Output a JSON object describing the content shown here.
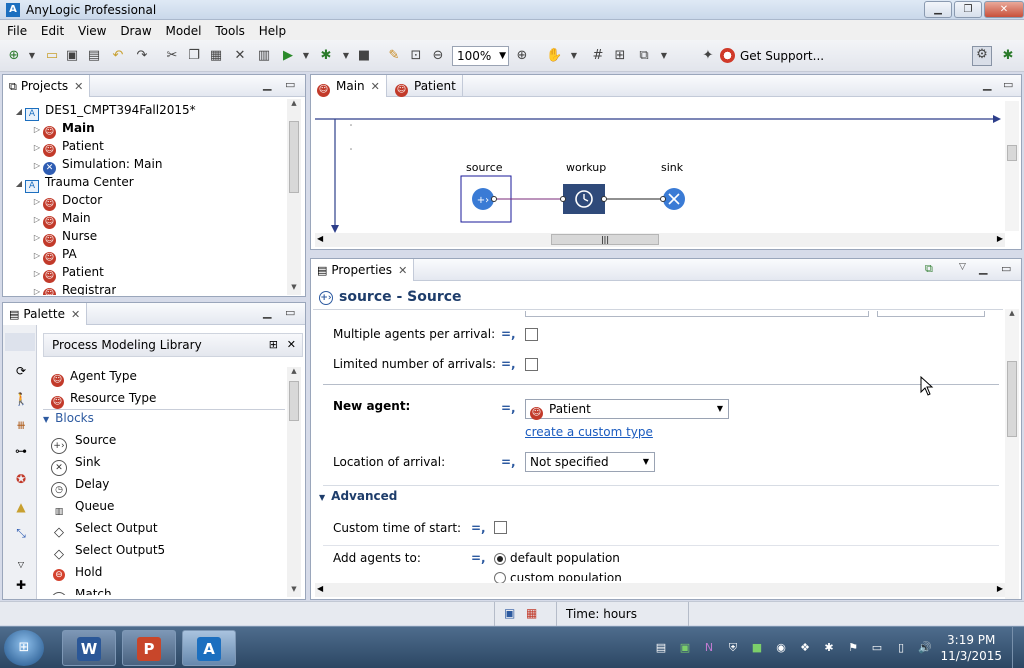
{
  "window": {
    "title": "AnyLogic Professional",
    "minimize": "▁",
    "maximize": "❐",
    "close": "✕"
  },
  "menu": [
    "File",
    "Edit",
    "View",
    "Draw",
    "Model",
    "Tools",
    "Help"
  ],
  "toolbar": {
    "zoom": "100%",
    "get_support": "Get Support..."
  },
  "projects": {
    "tab": "Projects",
    "items": [
      {
        "label": "DES1_CMPT394Fall2015*",
        "level": 0,
        "type": "project",
        "expanded": true
      },
      {
        "label": "Main",
        "level": 1,
        "type": "agent",
        "bold": true
      },
      {
        "label": "Patient",
        "level": 1,
        "type": "agent"
      },
      {
        "label": "Simulation: Main",
        "level": 1,
        "type": "sim"
      },
      {
        "label": "Trauma Center",
        "level": 0,
        "type": "project",
        "expanded": true
      },
      {
        "label": "Doctor",
        "level": 1,
        "type": "agent"
      },
      {
        "label": "Main",
        "level": 1,
        "type": "agent"
      },
      {
        "label": "Nurse",
        "level": 1,
        "type": "agent"
      },
      {
        "label": "PA",
        "level": 1,
        "type": "agent"
      },
      {
        "label": "Patient",
        "level": 1,
        "type": "agent"
      },
      {
        "label": "Registrar",
        "level": 1,
        "type": "agent"
      }
    ]
  },
  "palette": {
    "tab": "Palette",
    "library": "Process Modeling Library",
    "top_items": [
      "Agent Type",
      "Resource Type"
    ],
    "section": "Blocks",
    "blocks": [
      "Source",
      "Sink",
      "Delay",
      "Queue",
      "Select Output",
      "Select Output5",
      "Hold",
      "Match"
    ]
  },
  "editor": {
    "tabs": [
      "Main",
      "Patient"
    ],
    "blocks": [
      {
        "label": "source"
      },
      {
        "label": "workup"
      },
      {
        "label": "sink"
      }
    ]
  },
  "properties": {
    "tab": "Properties",
    "heading": "source - Source",
    "multiple_agents": "Multiple agents per arrival:",
    "limited_arrivals": "Limited number of arrivals:",
    "new_agent_label": "New agent:",
    "new_agent_value": "Patient",
    "create_link": "create a custom type",
    "location_label": "Location of arrival:",
    "location_value": "Not specified",
    "advanced": "Advanced",
    "custom_time_label": "Custom time of start:",
    "add_agents_label": "Add agents to:",
    "radio_default": "default population",
    "radio_custom": "custom population"
  },
  "status": {
    "time": "Time: hours"
  },
  "taskbar": {
    "time": "3:19 PM",
    "date": "11/3/2015",
    "word": "W",
    "ppt": "P",
    "anylogic": "A"
  }
}
